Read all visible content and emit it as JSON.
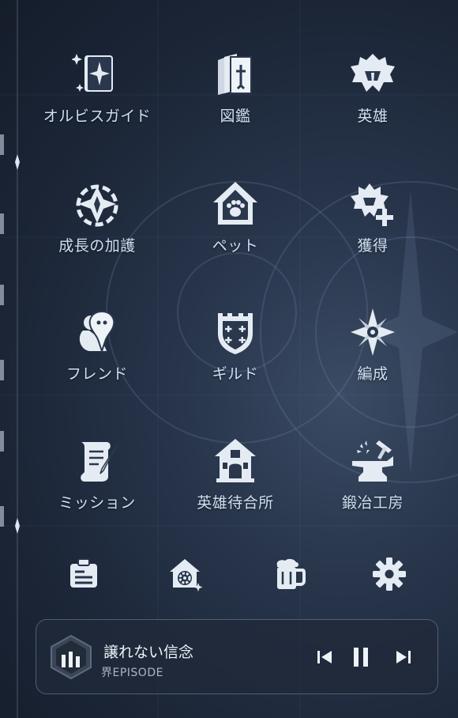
{
  "menu": {
    "items": [
      {
        "label": "オルビスガイド",
        "icon": "guide-book-icon"
      },
      {
        "label": "図鑑",
        "icon": "encyclopedia-icon"
      },
      {
        "label": "英雄",
        "icon": "hero-helmet-icon"
      },
      {
        "label": "成長の加護",
        "icon": "growth-blessing-icon"
      },
      {
        "label": "ペット",
        "icon": "pet-house-icon"
      },
      {
        "label": "獲得",
        "icon": "acquire-icon"
      },
      {
        "label": "フレンド",
        "icon": "friends-icon"
      },
      {
        "label": "ギルド",
        "icon": "guild-shield-icon"
      },
      {
        "label": "編成",
        "icon": "formation-compass-icon"
      },
      {
        "label": "ミッション",
        "icon": "mission-scroll-icon"
      },
      {
        "label": "英雄待合所",
        "icon": "hero-lodge-icon"
      },
      {
        "label": "鍛冶工房",
        "icon": "anvil-icon"
      }
    ]
  },
  "bottom_buttons": [
    {
      "name": "notice-button",
      "icon": "notice-board-icon"
    },
    {
      "name": "housing-settings-button",
      "icon": "house-gear-icon"
    },
    {
      "name": "tavern-button",
      "icon": "beer-mug-icon"
    },
    {
      "name": "settings-button",
      "icon": "gear-icon"
    }
  ],
  "player": {
    "title": "譲れない信念",
    "subtitle": "界EPISODE",
    "state": "playing",
    "album_icon": "equalizer-icon"
  },
  "colors": {
    "icon": "#e4ebf3",
    "label": "#cfe0f3",
    "background": "#1f2a3d"
  }
}
